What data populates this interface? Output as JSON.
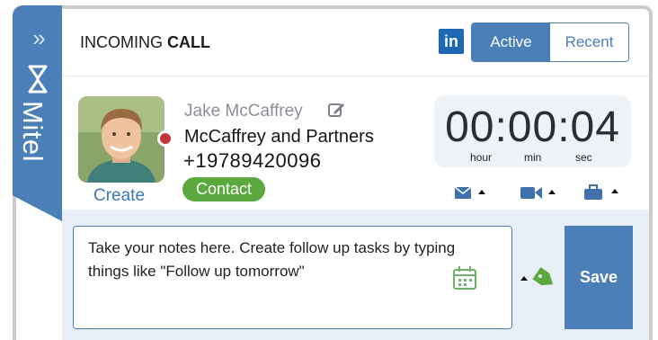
{
  "sidebar": {
    "collapse_glyph": "»",
    "brand": "Mitel"
  },
  "header": {
    "title_prefix": "INCOMING ",
    "title_bold": "CALL",
    "linkedin_label": "in",
    "tabs": [
      {
        "label": "Active",
        "active": true
      },
      {
        "label": "Recent",
        "active": false
      }
    ]
  },
  "caller": {
    "name": "Jake McCaffrey",
    "company": "McCaffrey and Partners",
    "phone": "+19789420096",
    "create_label": "Create",
    "contact_label": "Contact",
    "presence_color": "#c1353c"
  },
  "timer": {
    "value": "00:00:04",
    "units": [
      "hour",
      "min",
      "sec"
    ]
  },
  "actions": [
    {
      "icon": "email-icon"
    },
    {
      "icon": "video-icon"
    },
    {
      "icon": "briefcase-icon"
    }
  ],
  "notes": {
    "placeholder": "Take your notes here. Create follow up tasks by typing things like \"Follow up tomorrow\"",
    "save_label": "Save"
  },
  "colors": {
    "accent": "#4a7fb8",
    "contact_green": "#5aa83e",
    "linkedin": "#1d68b3"
  }
}
